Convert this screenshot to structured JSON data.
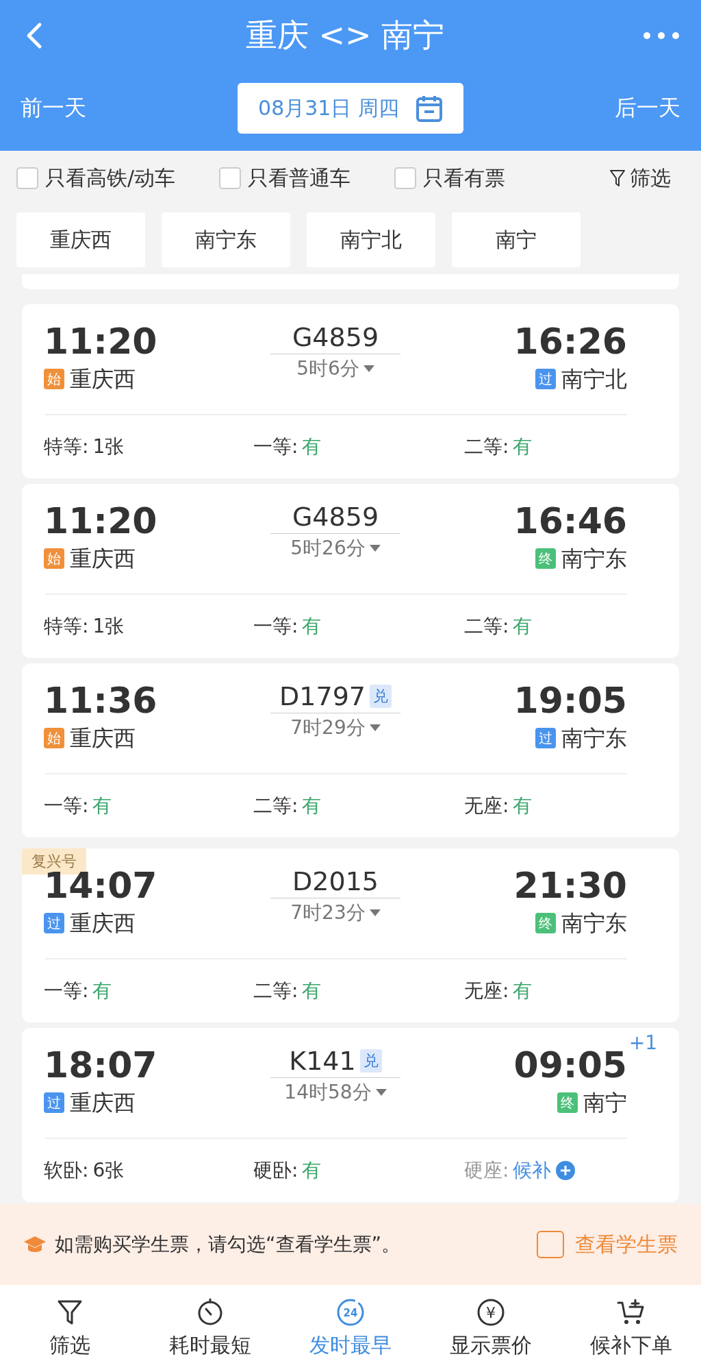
{
  "header": {
    "title": "重庆 <> 南宁",
    "prev_day": "前一天",
    "date": "08月31日 周四",
    "next_day": "后一天"
  },
  "filters": [
    {
      "label": "只看高铁/动车",
      "checked": false
    },
    {
      "label": "只看普通车",
      "checked": false
    },
    {
      "label": "只看有票",
      "checked": false
    }
  ],
  "filter_button": "筛选",
  "stations": [
    "重庆西",
    "南宁东",
    "南宁北",
    "南宁"
  ],
  "trains": [
    {
      "depart_time": "11:20",
      "depart_badge": {
        "text": "始",
        "color": "#f0903a"
      },
      "depart_station": "重庆西",
      "number": "G4859",
      "duration": "5时6分",
      "arrive_time": "16:26",
      "arrive_badge": {
        "text": "过",
        "color": "#4a94ee"
      },
      "arrive_station": "南宁北",
      "seats": [
        {
          "label": "特等:",
          "value": "1张",
          "kind": "count"
        },
        {
          "label": "一等:",
          "value": "有",
          "kind": "available"
        },
        {
          "label": "二等:",
          "value": "有",
          "kind": "available"
        }
      ]
    },
    {
      "depart_time": "11:20",
      "depart_badge": {
        "text": "始",
        "color": "#f0903a"
      },
      "depart_station": "重庆西",
      "number": "G4859",
      "duration": "5时26分",
      "arrive_time": "16:46",
      "arrive_badge": {
        "text": "终",
        "color": "#4cc07a"
      },
      "arrive_station": "南宁东",
      "seats": [
        {
          "label": "特等:",
          "value": "1张",
          "kind": "count"
        },
        {
          "label": "一等:",
          "value": "有",
          "kind": "available"
        },
        {
          "label": "二等:",
          "value": "有",
          "kind": "available"
        }
      ]
    },
    {
      "depart_time": "11:36",
      "depart_badge": {
        "text": "始",
        "color": "#f0903a"
      },
      "depart_station": "重庆西",
      "number": "D1797",
      "exchange_tag": "兑",
      "duration": "7时29分",
      "arrive_time": "19:05",
      "arrive_badge": {
        "text": "过",
        "color": "#4a94ee"
      },
      "arrive_station": "南宁东",
      "seats": [
        {
          "label": "一等:",
          "value": "有",
          "kind": "available"
        },
        {
          "label": "二等:",
          "value": "有",
          "kind": "available"
        },
        {
          "label": "无座:",
          "value": "有",
          "kind": "available"
        }
      ]
    },
    {
      "corner_tag": "复兴号",
      "depart_time": "14:07",
      "depart_badge": {
        "text": "过",
        "color": "#4a94ee"
      },
      "depart_station": "重庆西",
      "number": "D2015",
      "duration": "7时23分",
      "arrive_time": "21:30",
      "arrive_badge": {
        "text": "终",
        "color": "#4cc07a"
      },
      "arrive_station": "南宁东",
      "seats": [
        {
          "label": "一等:",
          "value": "有",
          "kind": "available"
        },
        {
          "label": "二等:",
          "value": "有",
          "kind": "available"
        },
        {
          "label": "无座:",
          "value": "有",
          "kind": "available"
        }
      ]
    },
    {
      "depart_time": "18:07",
      "depart_badge": {
        "text": "过",
        "color": "#4a94ee"
      },
      "depart_station": "重庆西",
      "number": "K141",
      "exchange_tag": "兑",
      "duration": "14时58分",
      "arrive_time": "09:05",
      "next_day": "+1",
      "arrive_badge": {
        "text": "终",
        "color": "#4cc07a"
      },
      "arrive_station": "南宁",
      "seats": [
        {
          "label": "软卧:",
          "value": "6张",
          "kind": "count"
        },
        {
          "label": "硬卧:",
          "value": "有",
          "kind": "available"
        },
        {
          "label": "硬座:",
          "value": "候补",
          "kind": "waitlist"
        }
      ]
    }
  ],
  "student_banner": {
    "text": "如需购买学生票，请勾选“查看学生票”。",
    "checkbox_label": "查看学生票",
    "checked": false
  },
  "tab_bar": [
    {
      "label": "筛选",
      "kind": "filter",
      "selected": false
    },
    {
      "label": "耗时最短",
      "kind": "timer",
      "selected": false
    },
    {
      "label": "发时最早",
      "kind": "clock24",
      "icon_text": "24",
      "selected": true
    },
    {
      "label": "显示票价",
      "kind": "price",
      "icon_text": "¥",
      "selected": false
    },
    {
      "label": "候补下单",
      "kind": "cart",
      "selected": false
    }
  ]
}
